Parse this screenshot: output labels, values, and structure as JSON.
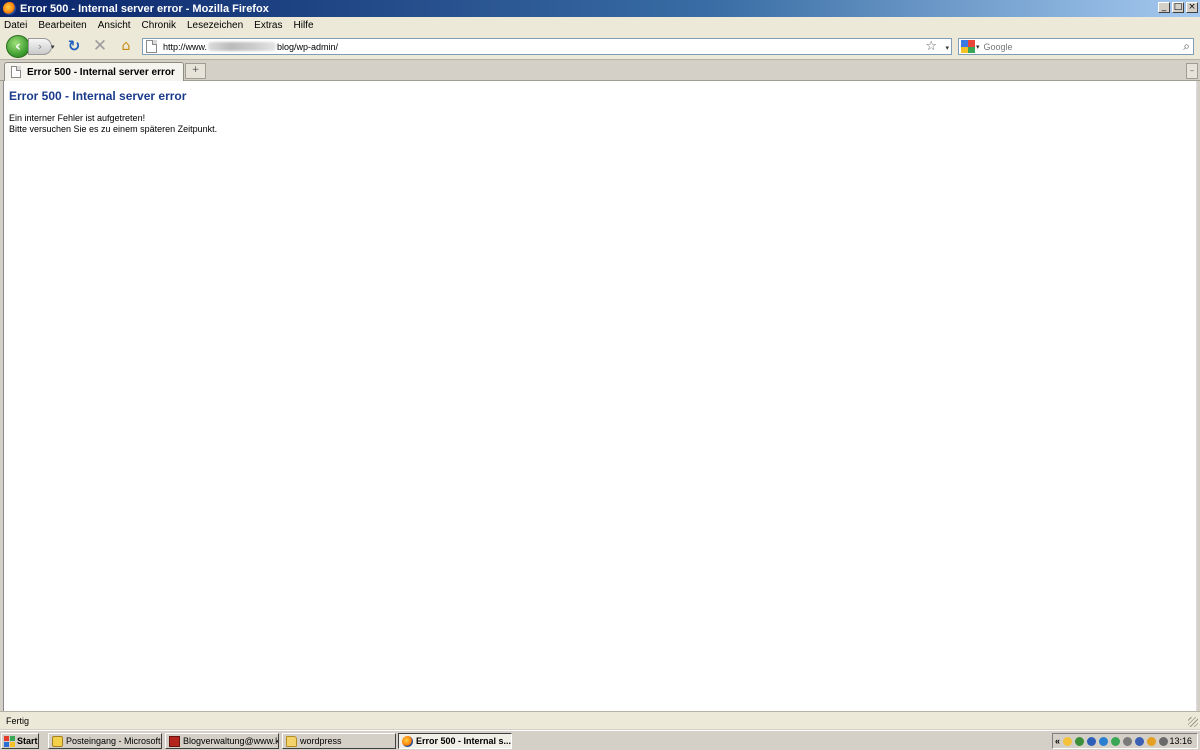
{
  "window": {
    "title": "Error 500 - Internal server error - Mozilla Firefox",
    "controls": {
      "minimize": "_",
      "maximize": "□",
      "close": "×"
    }
  },
  "menu": {
    "items": [
      "Datei",
      "Bearbeiten",
      "Ansicht",
      "Chronik",
      "Lesezeichen",
      "Extras",
      "Hilfe"
    ]
  },
  "navigation": {
    "back": "‹",
    "forward": "›",
    "dropdown": "▾",
    "reload": "↻",
    "stop": "✕",
    "home": "⌂",
    "url_prefix": "http://www.",
    "url_suffix": "blog/wp-admin/",
    "bookmark_star": "☆",
    "search_placeholder": "Google",
    "search_go": "⌕"
  },
  "tabs": {
    "active_label": "Error 500 - Internal server error",
    "new_tab": "+",
    "list": "–"
  },
  "page": {
    "heading": "Error 500 - Internal server error",
    "line1": "Ein interner Fehler ist aufgetreten!",
    "line2": "Bitte versuchen Sie es zu einem späteren Zeitpunkt."
  },
  "status": {
    "text": "Fertig"
  },
  "taskbar": {
    "start": "Start",
    "tasks": [
      "Posteingang - Microsoft ...",
      "Blogverwaltung@www.kl...",
      "wordpress",
      "Error 500 - Internal s..."
    ],
    "tray_arrow": "«",
    "clock": "13:16",
    "tray_colors": [
      "#f3c13a",
      "#3a8f3a",
      "#2d5fb8",
      "#2a7fd0",
      "#3aa757",
      "#7a7a7a",
      "#3a5fb5",
      "#e4a021",
      "#6a6a6a"
    ]
  },
  "colors": {
    "heading": "#1a3a8c",
    "titlebar_start": "#0a246a",
    "titlebar_end": "#a6caf0"
  }
}
